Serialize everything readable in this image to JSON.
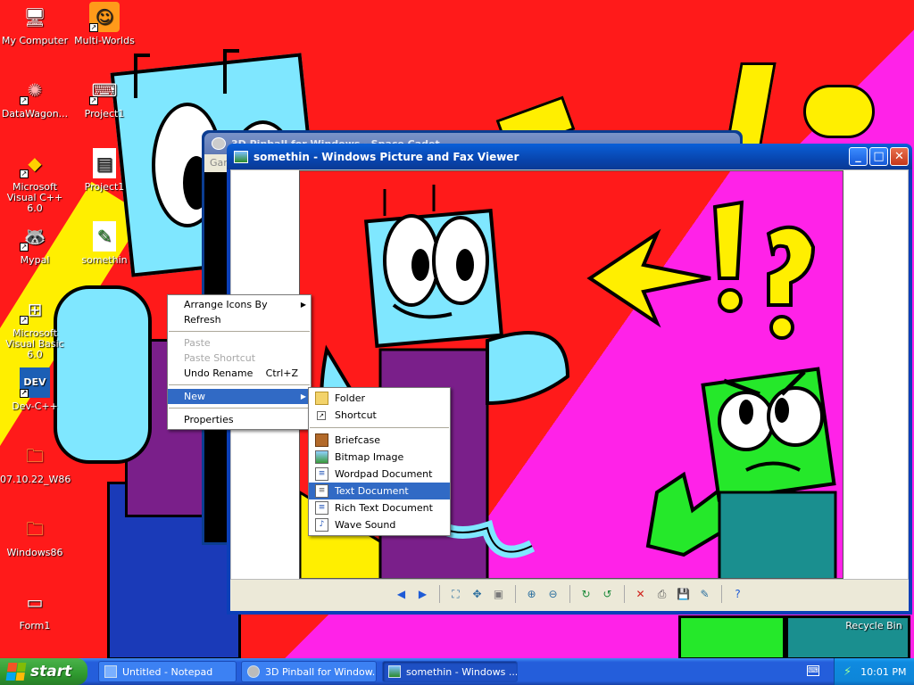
{
  "desktop": {
    "icons": [
      {
        "label": "My Computer",
        "glyph": "🖥"
      },
      {
        "label": "Multi-Worlds",
        "glyph": "☺"
      },
      {
        "label": "DataWagon...",
        "glyph": "✺"
      },
      {
        "label": "Project1",
        "glyph": "⌨"
      },
      {
        "label": "Microsoft Visual C++ 6.0",
        "glyph": "◆"
      },
      {
        "label": "Project1",
        "glyph": "▤"
      },
      {
        "label": "Mypal",
        "glyph": "🦝"
      },
      {
        "label": "somethin",
        "glyph": "✎"
      },
      {
        "label": "Microsoft Visual Basic 6.0",
        "glyph": "⊞"
      },
      {
        "label": "Dev-C++",
        "glyph": "DEV"
      },
      {
        "label": "07.10.22_W86",
        "glyph": "🗀"
      },
      {
        "label": "Windows86",
        "glyph": "🗀"
      },
      {
        "label": "Form1",
        "glyph": "▭"
      },
      {
        "label": "Recycle Bin",
        "glyph": ""
      }
    ]
  },
  "pinball_window": {
    "title": "3D Pinball for Windows - Space Cadet",
    "menu_label": "Gam"
  },
  "viewer_window": {
    "title": "somethin - Windows Picture and Fax Viewer",
    "minimize": "_",
    "maximize": "□",
    "close": "✕",
    "toolbar": [
      {
        "name": "previous-image-button",
        "glyph": "◀",
        "color": "#1e5bd6"
      },
      {
        "name": "next-image-button",
        "glyph": "▶",
        "color": "#1e5bd6"
      },
      {
        "sep": true
      },
      {
        "name": "best-fit-button",
        "glyph": "⛶",
        "color": "#2a6e9e"
      },
      {
        "name": "actual-size-button",
        "glyph": "✥",
        "color": "#2a6e9e"
      },
      {
        "name": "slideshow-button",
        "glyph": "▣",
        "color": "#7a7a7a"
      },
      {
        "sep": true
      },
      {
        "name": "zoom-in-button",
        "glyph": "⊕",
        "color": "#2a6e9e"
      },
      {
        "name": "zoom-out-button",
        "glyph": "⊖",
        "color": "#2a6e9e"
      },
      {
        "sep": true
      },
      {
        "name": "rotate-clockwise-button",
        "glyph": "↻",
        "color": "#1c8a3a"
      },
      {
        "name": "rotate-counterclockwise-button",
        "glyph": "↺",
        "color": "#1c8a3a"
      },
      {
        "sep": true
      },
      {
        "name": "delete-button",
        "glyph": "✕",
        "color": "#d0201a"
      },
      {
        "name": "print-button",
        "glyph": "⎙",
        "color": "#555"
      },
      {
        "name": "save-button",
        "glyph": "💾",
        "color": "#2a4e9e"
      },
      {
        "name": "edit-button",
        "glyph": "✎",
        "color": "#2a6e9e"
      },
      {
        "sep": true
      },
      {
        "name": "help-button",
        "glyph": "?",
        "color": "#1e5bd6"
      }
    ]
  },
  "context_menu": {
    "arrange_icons_by": "Arrange Icons By",
    "refresh": "Refresh",
    "paste": "Paste",
    "paste_shortcut": "Paste Shortcut",
    "undo_rename": "Undo Rename",
    "undo_rename_accel": "Ctrl+Z",
    "new": "New",
    "properties": "Properties"
  },
  "new_submenu": {
    "folder": "Folder",
    "shortcut": "Shortcut",
    "briefcase": "Briefcase",
    "bitmap_image": "Bitmap Image",
    "wordpad_document": "Wordpad Document",
    "text_document": "Text Document",
    "rich_text_document": "Rich Text Document",
    "wave_sound": "Wave Sound"
  },
  "taskbar": {
    "start_label": "start",
    "tasks": [
      "Untitled - Notepad",
      "3D Pinball for Window...",
      "somethin - Windows ..."
    ],
    "clock": "10:01 PM"
  },
  "colors": {
    "wallpaper_red": "#ff1a1a",
    "wallpaper_magenta": "#ff22e8",
    "menu_highlight": "#316ac5",
    "taskbar_blue": "#245edb",
    "start_green": "#2f9a2f"
  }
}
